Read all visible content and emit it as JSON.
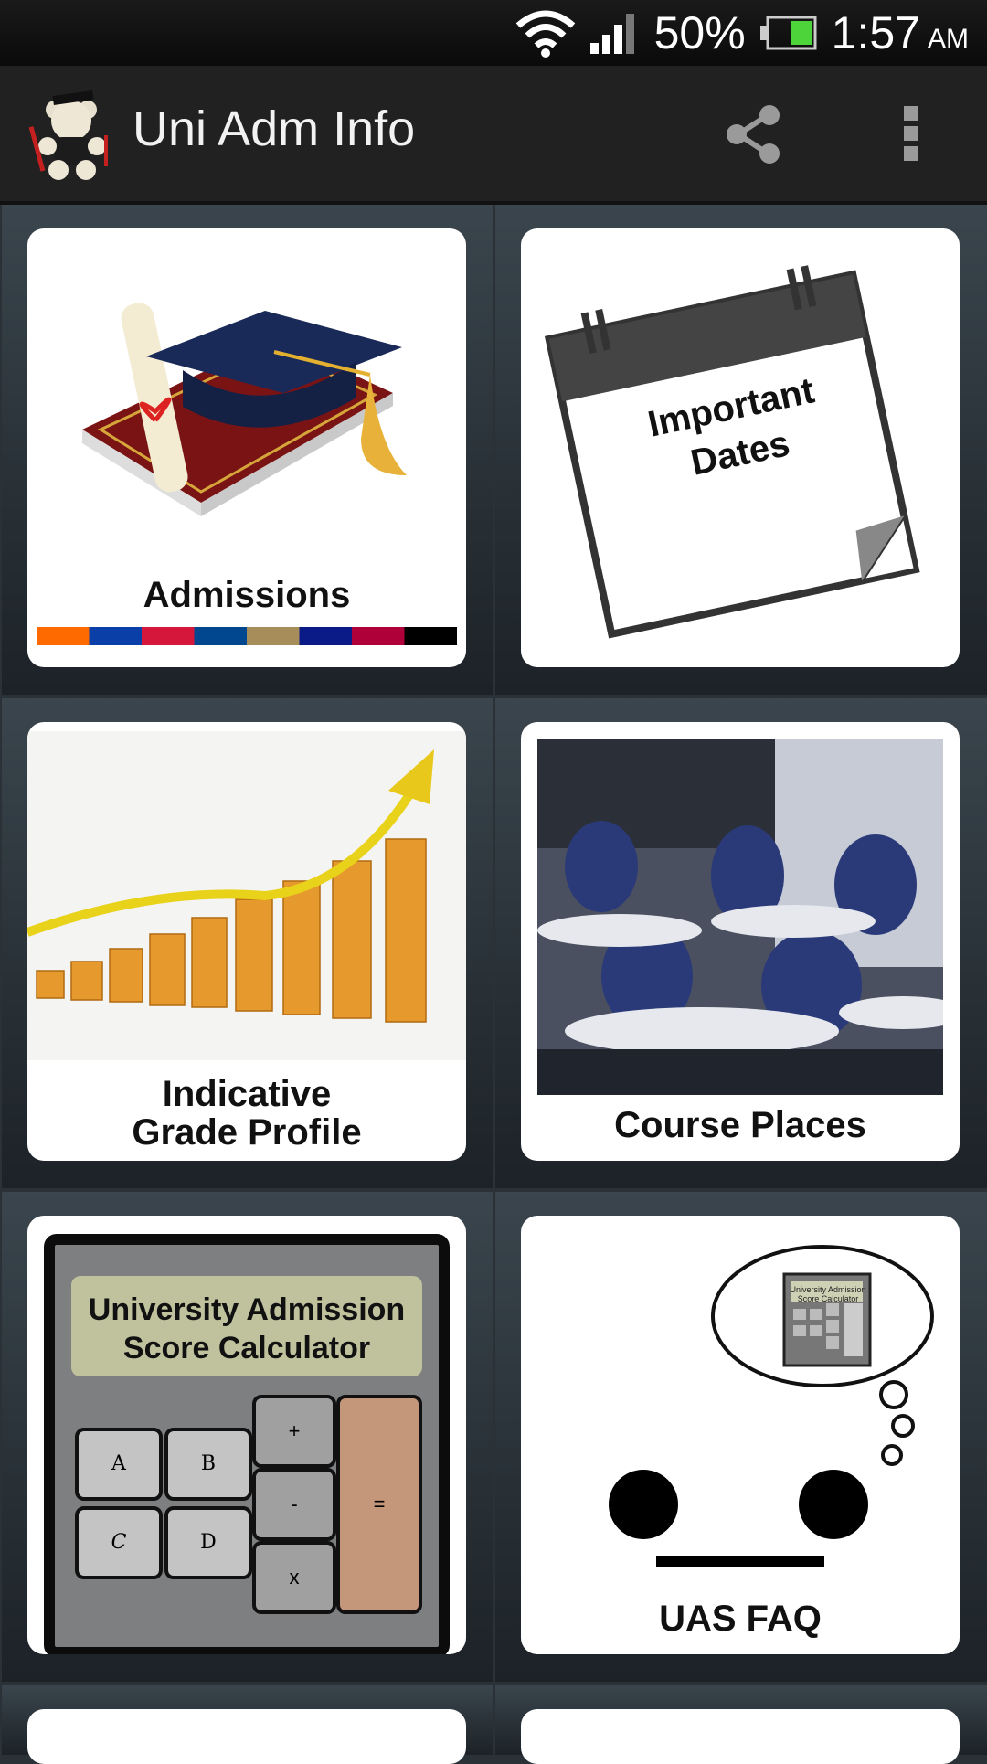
{
  "status_bar": {
    "battery": "50%",
    "time": "1:57",
    "ampm": "AM"
  },
  "app_bar": {
    "title": "Uni Adm Info"
  },
  "tiles": {
    "admissions": {
      "label": "Admissions"
    },
    "dates": {
      "line1": "Important",
      "line2": "Dates"
    },
    "grade_profile": {
      "line1": "Indicative",
      "line2": "Grade Profile"
    },
    "course_places": {
      "label": "Course Places"
    },
    "calculator": {
      "line1": "University Admission",
      "line2": "Score Calculator",
      "keys": [
        "A",
        "B",
        "C",
        "D",
        "+",
        "-",
        "x",
        "="
      ]
    },
    "faq": {
      "label": "UAS FAQ",
      "thought_line1": "University Admission",
      "thought_line2": "Score Calculator"
    }
  },
  "colors": {
    "stripe": [
      "#ff6a00",
      "#0a3fa8",
      "#d4173a",
      "#00478f",
      "#a68d5a",
      "#0a1a86",
      "#b0003a",
      "#000000"
    ]
  }
}
